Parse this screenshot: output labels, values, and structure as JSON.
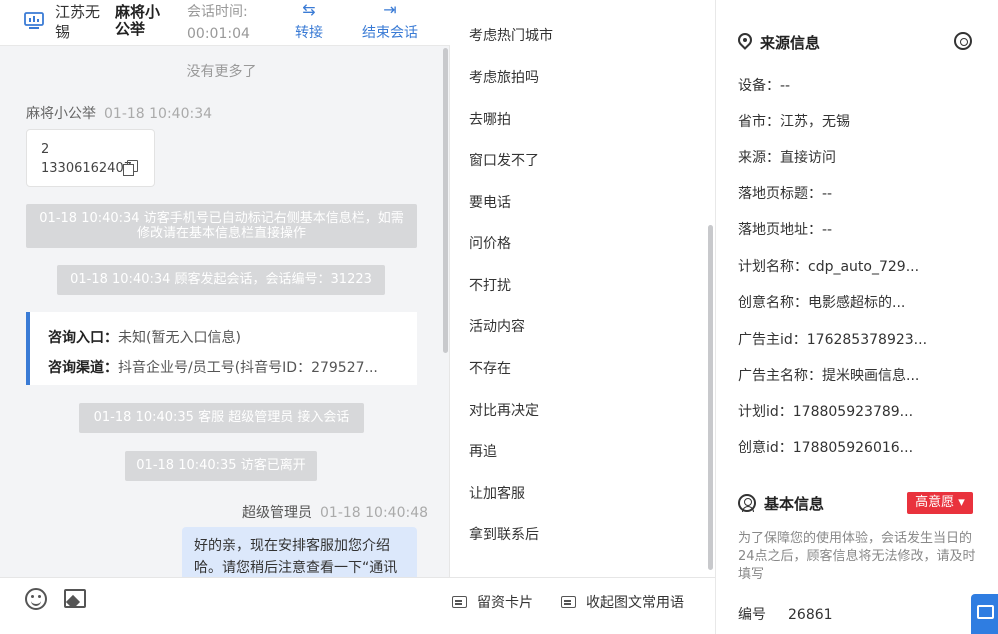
{
  "topbar": {
    "city": "江苏无锡",
    "visitor_name": "麻将小公举",
    "time_label": "会话时间:",
    "time_value": "00:01:04",
    "transfer_label": "转接",
    "end_label": "结束会话",
    "accent_color": "#3a7bd5"
  },
  "chat": {
    "no_more": "没有更多了",
    "visitor_sender": "麻将小公举",
    "visitor_time": "01-18 10:40:34",
    "card_line1": "2",
    "card_line2": "13306162407",
    "sys1": "01-18 10:40:34 访客手机号已自动标记右侧基本信息栏，如需修改请在基本信息栏直接操作",
    "sys2": "01-18 10:40:34 顾客发起会话，会话编号：31223",
    "entry_label": "咨询入口：",
    "entry_value": "未知(暂无入口信息)",
    "channel_label": "咨询渠道：",
    "channel_value": "抖音企业号/员工号(抖音号ID：279527...",
    "sys3": "01-18 10:40:35 客服 超级管理员 接入会话",
    "sys4": "01-18 10:40:35 访客已离开",
    "agent_sender": "超级管理员",
    "agent_time": "01-18 10:40:48",
    "agent_message": "好的亲，现在安排客服加您介绍哈。请您稍后注意查看一下“通讯"
  },
  "input_bar": {
    "card_button": "留资卡片",
    "collapse_button": "收起图文常用语"
  },
  "quick_replies": [
    "考虑热门城市",
    "考虑旅拍吗",
    "去哪拍",
    "窗口发不了",
    "要电话",
    "问价格",
    "不打扰",
    "活动内容",
    "不存在",
    "对比再决定",
    "再追",
    "让加客服",
    "拿到联系后"
  ],
  "source_info": {
    "title": "来源信息",
    "fields": [
      "设备：--",
      "省市：江苏，无锡",
      "来源：直接访问",
      "落地页标题：--",
      "落地页地址：--",
      "计划名称：cdp_auto_729...",
      "创意名称：电影感超标的...",
      "广告主id：176285378923...",
      "广告主名称：提米映画信息...",
      "计划id：178805923789...",
      "创意id：178805926016..."
    ]
  },
  "basic_info": {
    "title": "基本信息",
    "badge": "高意愿",
    "badge_color": "#e9323d",
    "tip": "为了保障您的使用体验，会话发生当日的24点之后，顾客信息将无法修改，请及时填写",
    "id_label": "编号",
    "id_value": "26861"
  }
}
